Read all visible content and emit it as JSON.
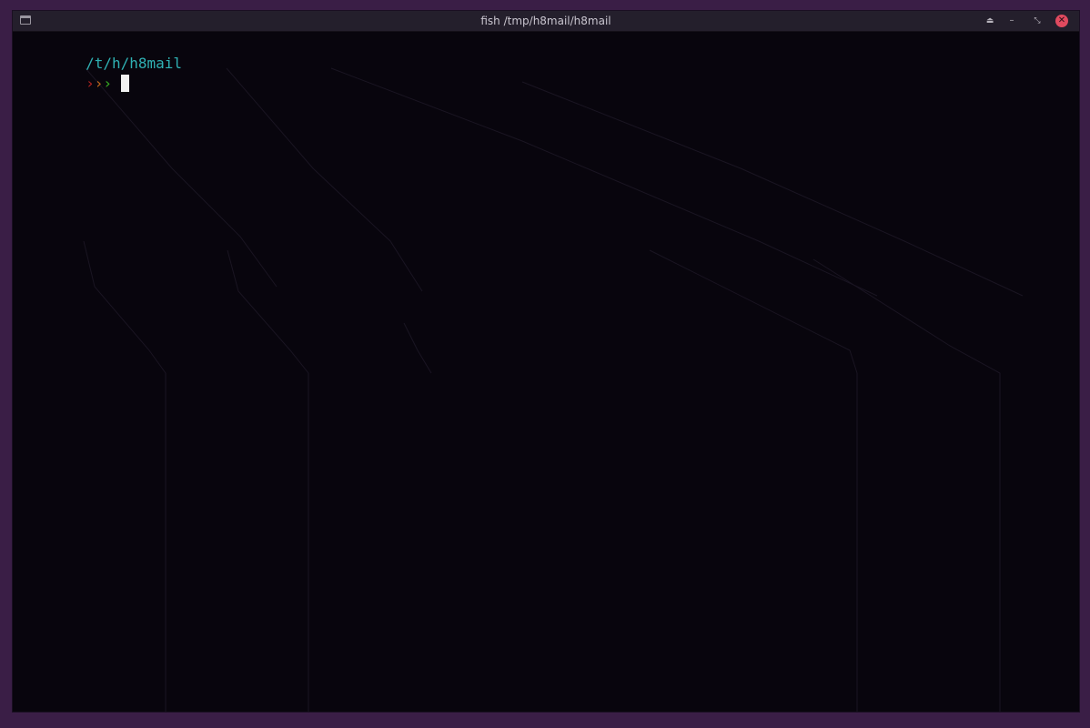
{
  "window": {
    "title": "fish /tmp/h8mail/h8mail",
    "app_icon": "terminal-icon",
    "controls": {
      "keep_above": {
        "icon": "eject-icon",
        "glyph": "⏏"
      },
      "minimize": {
        "icon": "minimize-icon",
        "glyph": "–"
      },
      "maximize": {
        "icon": "restore-icon",
        "glyph": "⤡"
      },
      "close": {
        "icon": "close-icon",
        "glyph": "✕"
      }
    }
  },
  "terminal": {
    "prompt": {
      "cwd": "/t/h/h8mail",
      "arrow1": "›",
      "arrow2": "›",
      "arrow3": "›"
    },
    "input": ""
  },
  "colors": {
    "background": "#08050d",
    "titlebar": "#241f2c",
    "frame": "#3a1e46",
    "cwd": "#2fb1b4",
    "arrow_red": "#b0221f",
    "arrow_orange": "#c0681a",
    "arrow_green": "#38b023",
    "cursor": "#f2f2f2",
    "close": "#e04a5f"
  }
}
